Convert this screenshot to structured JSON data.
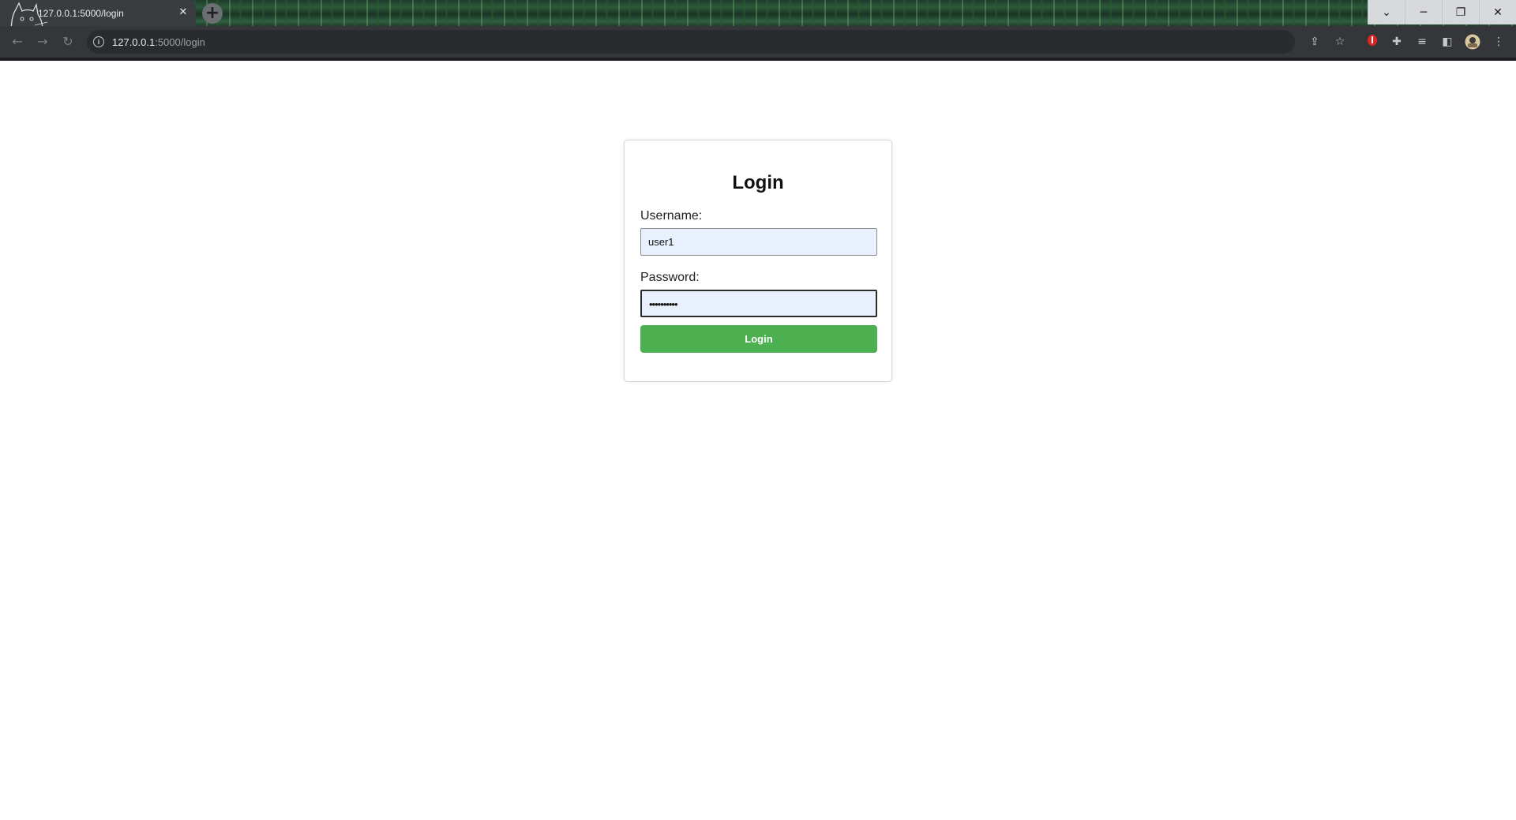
{
  "browser": {
    "tab_title": "127.0.0.1:5000/login",
    "tab_close": "✕",
    "new_tab": "+",
    "url_host": "127.0.0.1",
    "url_path": ":5000/login",
    "window_controls": {
      "dropdown": "⌄",
      "minimize": "─",
      "restore": "❐",
      "close": "✕"
    },
    "icons": [
      "back-icon",
      "forward-icon",
      "reload-icon",
      "info-icon",
      "share-icon",
      "bookmark-star-icon",
      "extension-red-icon",
      "extensions-puzzle-icon",
      "reading-list-icon",
      "side-panel-icon",
      "profile-avatar-icon",
      "menu-kebab-icon"
    ]
  },
  "login": {
    "heading": "Login",
    "username_label": "Username:",
    "username_value": "user1",
    "password_label": "Password:",
    "password_value": "••••••••••",
    "submit_label": "Login"
  },
  "colors": {
    "button": "#4caf50",
    "input_autofill": "#e8f0fe",
    "toolbar": "#35363a"
  }
}
